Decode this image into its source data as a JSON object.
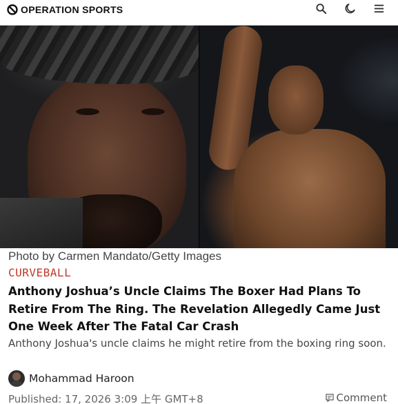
{
  "site": {
    "name": "OPERATION SPORTS"
  },
  "header": {
    "icons": [
      "search-icon",
      "moon-icon",
      "menu-icon"
    ]
  },
  "article": {
    "photo_credit": "Photo by Carmen Mandato/Getty Images",
    "category": "CURVEBALL",
    "headline": "Anthony Joshua’s Uncle Claims The Boxer Had Plans To Retire From The Ring. The Revelation Allegedly Came Just One Week After The Fatal Car Crash",
    "summary": "Anthony Joshua's uncle claims he might retire from the boxing ring soon.",
    "author": "Mohammad Haroon",
    "published": "Published: 17, 2026 3:09 上午 GMT+8",
    "comment_label": "Comment"
  },
  "colors": {
    "category": "#c0392b",
    "text": "#111111",
    "muted": "#666666"
  }
}
